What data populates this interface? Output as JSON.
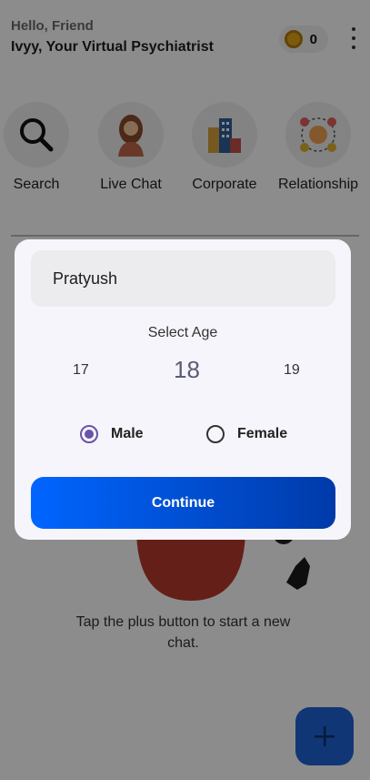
{
  "header": {
    "greeting": "Hello, Friend",
    "subtitle": "Ivyy, Your Virtual Psychiatrist",
    "coins": "0"
  },
  "categories": [
    {
      "label": "Search",
      "icon": "search-icon"
    },
    {
      "label": "Live Chat",
      "icon": "woman-avatar-icon"
    },
    {
      "label": "Corporate",
      "icon": "office-building-icon"
    },
    {
      "label": "Relationship",
      "icon": "network-people-icon"
    }
  ],
  "empty_state": {
    "text": "Tap the plus button to start a new chat."
  },
  "dialog": {
    "name_value": "Pratyush",
    "age_title": "Select Age",
    "ages": {
      "prev": "17",
      "selected": "18",
      "next": "19"
    },
    "gender": {
      "male": "Male",
      "female": "Female",
      "selected": "Male"
    },
    "continue_label": "Continue"
  },
  "colors": {
    "primary": "#0065ff",
    "radio": "#6a53a8",
    "fab": "#1f63d6"
  }
}
